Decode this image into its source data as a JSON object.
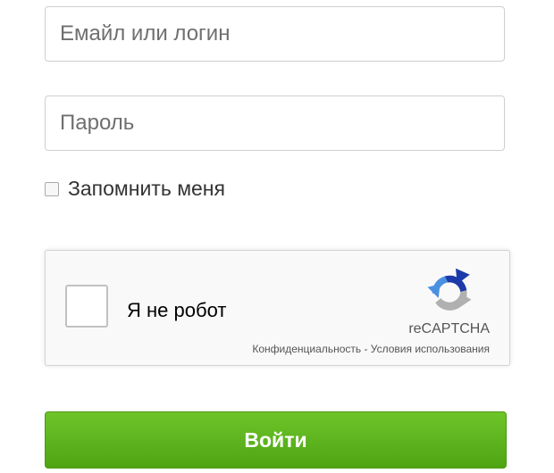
{
  "form": {
    "login": {
      "value": "",
      "placeholder": "Емайл или логин"
    },
    "password": {
      "value": "",
      "placeholder": "Пароль"
    },
    "remember_label": "Запомнить меня",
    "remember_checked": false,
    "submit_label": "Войти"
  },
  "captcha": {
    "label": "Я не робот",
    "brand": "reCAPTCHA",
    "privacy_link": "Конфиденциальность",
    "separator": " - ",
    "terms_link": "Условия использования",
    "checked": false,
    "icon": "recaptcha-logo-icon"
  },
  "colors": {
    "button_green": "#5cb31c",
    "captcha_blue": "#1c3aa9",
    "captcha_lightblue": "#4a90e2",
    "captcha_gray": "#b0b0b0"
  }
}
